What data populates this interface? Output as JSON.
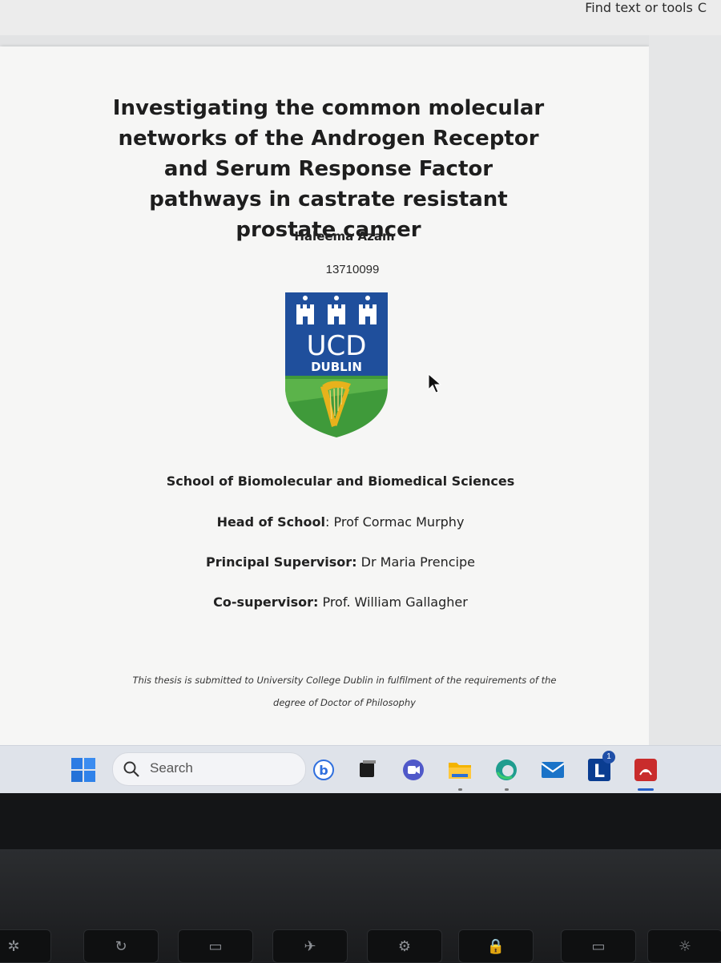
{
  "toolbar": {
    "find_label": "Find text or tools"
  },
  "document": {
    "title": "Investigating the common molecular networks of the Androgen Receptor and Serum Response Factor pathways in castrate resistant prostate cancer",
    "author": "Haleema Azam",
    "student_id": "13710099",
    "logo": {
      "text_main": "UCD",
      "text_sub": "DUBLIN",
      "colors": {
        "blue": "#1f4f9c",
        "green": "#3f9a3a",
        "gold": "#e7b21c"
      }
    },
    "school": "School of Biomolecular and Biomedical Sciences",
    "head_of_school": {
      "label": "Head of School",
      "value": ": Prof Cormac Murphy"
    },
    "principal_supervisor": {
      "label": "Principal Supervisor:",
      "value": " Dr Maria Prencipe"
    },
    "co_supervisor": {
      "label": "Co-supervisor:",
      "value": " Prof. William Gallagher"
    },
    "footnote_line1": "This thesis is submitted to University College Dublin in fulfilment of the requirements of the",
    "footnote_line2": "degree of Doctor of Philosophy"
  },
  "taskbar": {
    "search_placeholder": "Search",
    "apps": [
      "start-icon",
      "bing-icon",
      "task-view-icon",
      "teams-meet-icon",
      "file-explorer-icon",
      "edge-icon",
      "mail-icon",
      "linkedin-learning-icon",
      "acrobat-icon"
    ],
    "notification_badge": "1",
    "accent": "#2860c8"
  }
}
